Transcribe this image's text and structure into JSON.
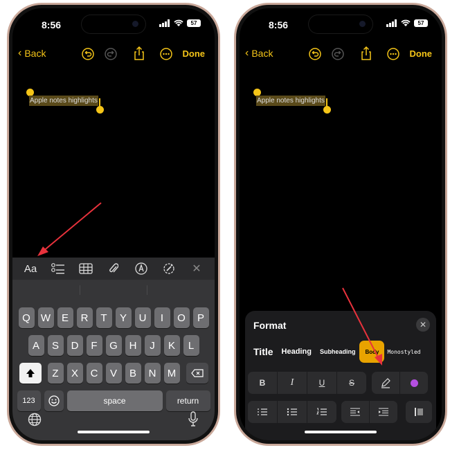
{
  "status": {
    "time": "8:56",
    "battery": "57"
  },
  "nav": {
    "back_label": "Back",
    "done_label": "Done"
  },
  "note": {
    "text": "Apple notes highlights"
  },
  "toolbar": {
    "format_label": "Aa"
  },
  "keyboard": {
    "row1": [
      "Q",
      "W",
      "E",
      "R",
      "T",
      "Y",
      "U",
      "I",
      "O",
      "P"
    ],
    "row2": [
      "A",
      "S",
      "D",
      "F",
      "G",
      "H",
      "J",
      "K",
      "L"
    ],
    "row3": [
      "Z",
      "X",
      "C",
      "V",
      "B",
      "N",
      "M"
    ],
    "numbers_label": "123",
    "space_label": "space",
    "return_label": "return"
  },
  "format_panel": {
    "title": "Format",
    "styles": [
      "Title",
      "Heading",
      "Subheading",
      "Body",
      "Monostyled"
    ],
    "active_style": "Body",
    "bold_label": "B",
    "italic_label": "I",
    "underline_label": "U",
    "strike_label": "S",
    "highlight_color": "#b44fe0"
  },
  "colors": {
    "accent": "#f5c518",
    "annotation_arrow": "#e8323c",
    "selection": "#5a4a1a"
  }
}
